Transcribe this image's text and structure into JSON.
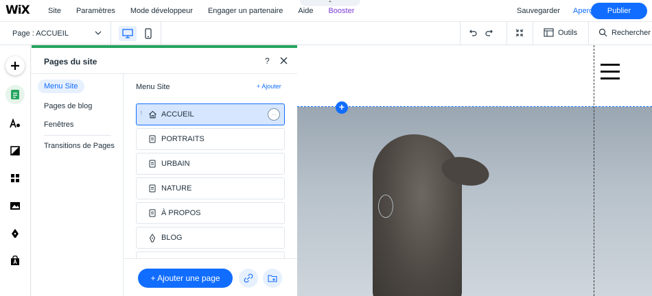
{
  "topbar": {
    "logo": "WiX",
    "menu": [
      "Site",
      "Paramètres",
      "Mode développeur",
      "Engager un partenaire",
      "Aide",
      "Booster"
    ],
    "save": "Sauvegarder",
    "preview": "Aperçu",
    "publish": "Publier"
  },
  "toolbar": {
    "page_label": "Page : ACCUEIL",
    "tools_label": "Outils",
    "search_label": "Rechercher"
  },
  "panel": {
    "title": "Pages du site",
    "help": "?",
    "nav": [
      "Menu Site",
      "Pages de blog",
      "Fenêtres",
      "Transitions de Pages"
    ],
    "menu_label": "Menu Site",
    "add_link": "+ Ajouter",
    "pages": [
      {
        "label": "ACCUEIL",
        "icon": "home-icon",
        "selected": true
      },
      {
        "label": "PORTRAITS",
        "icon": "page-icon"
      },
      {
        "label": "URBAIN",
        "icon": "page-icon"
      },
      {
        "label": "NATURE",
        "icon": "page-icon"
      },
      {
        "label": "À PROPOS",
        "icon": "page-icon"
      },
      {
        "label": "BLOG",
        "icon": "blog-pen-icon"
      }
    ],
    "add_page": "+ Ajouter une page",
    "more": "···"
  },
  "canvas": {
    "add_section": "+"
  },
  "colors": {
    "accent": "#116dff",
    "pages_green": "#25a55f"
  }
}
